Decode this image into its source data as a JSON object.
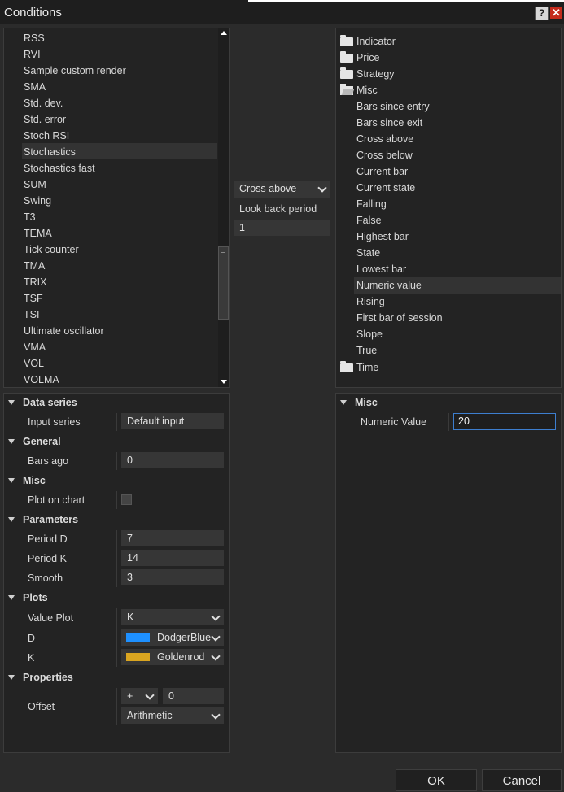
{
  "window": {
    "title": "Conditions",
    "help": "?",
    "close": "✕"
  },
  "indicator_list": [
    "RSS",
    "RVI",
    "Sample custom render",
    "SMA",
    "Std. dev.",
    "Std. error",
    "Stoch RSI",
    "Stochastics",
    "Stochastics fast",
    "SUM",
    "Swing",
    "T3",
    "TEMA",
    "Tick counter",
    "TMA",
    "TRIX",
    "TSF",
    "TSI",
    "Ultimate oscillator",
    "VMA",
    "VOL",
    "VOLMA"
  ],
  "indicator_selected": "Stochastics",
  "middle": {
    "operator": "Cross above",
    "lookback_label": "Look back period",
    "lookback_value": "1"
  },
  "tree": {
    "folders": [
      "Indicator",
      "Price",
      "Strategy",
      "Misc",
      "Time"
    ],
    "misc_items": [
      "Bars since entry",
      "Bars since exit",
      "Cross above",
      "Cross below",
      "Current bar",
      "Current state",
      "Falling",
      "False",
      "Highest bar",
      "State",
      "Lowest bar",
      "Numeric value",
      "Rising",
      "First bar of session",
      "Slope",
      "True"
    ],
    "selected": "Numeric value"
  },
  "left_props": {
    "data_series": {
      "title": "Data series",
      "input_series_label": "Input series",
      "input_series_value": "Default input"
    },
    "general": {
      "title": "General",
      "bars_ago_label": "Bars ago",
      "bars_ago_value": "0"
    },
    "misc": {
      "title": "Misc",
      "plot_on_chart_label": "Plot on chart",
      "plot_on_chart": false
    },
    "parameters": {
      "title": "Parameters",
      "period_d_label": "Period D",
      "period_d": "7",
      "period_k_label": "Period K",
      "period_k": "14",
      "smooth_label": "Smooth",
      "smooth": "3"
    },
    "plots": {
      "title": "Plots",
      "value_plot_label": "Value Plot",
      "value_plot": "K",
      "d_label": "D",
      "d_color_name": "DodgerBlue",
      "d_color": "#1e90ff",
      "k_label": "K",
      "k_color_name": "Goldenrod",
      "k_color": "#daa520"
    },
    "properties": {
      "title": "Properties",
      "offset_label": "Offset",
      "offset_sign": "+",
      "offset_value": "0",
      "offset_type": "Arithmetic"
    }
  },
  "right_props": {
    "title": "Misc",
    "numeric_value_label": "Numeric Value",
    "numeric_value": "20"
  },
  "buttons": {
    "ok": "OK",
    "cancel": "Cancel"
  }
}
